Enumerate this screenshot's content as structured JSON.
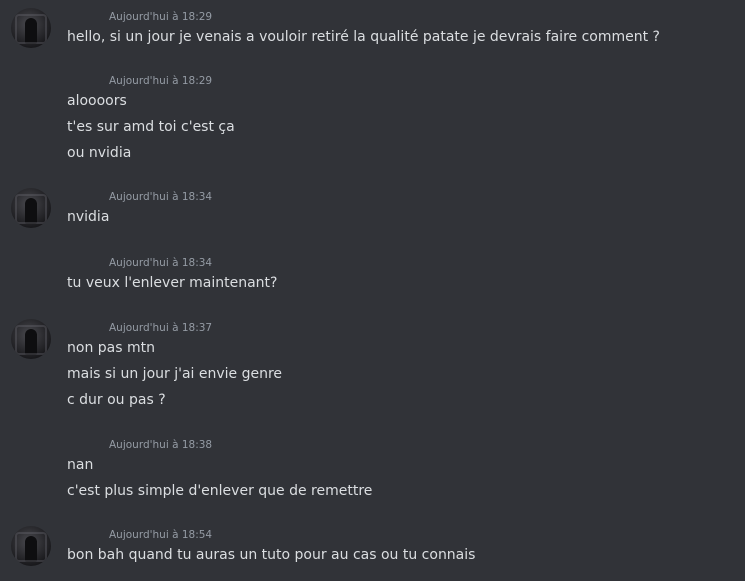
{
  "messages": [
    {
      "timestamp": "Aujourd'hui à 18:29",
      "lines": [
        "hello, si un jour je venais a vouloir retiré la qualité patate je devrais faire comment ?"
      ]
    },
    {
      "timestamp": "Aujourd'hui à 18:29",
      "lines": [
        "aloooors",
        "t'es sur amd toi c'est ça",
        "ou nvidia"
      ]
    },
    {
      "timestamp": "Aujourd'hui à 18:34",
      "lines": [
        "nvidia"
      ]
    },
    {
      "timestamp": "Aujourd'hui à 18:34",
      "lines": [
        "tu veux l'enlever maintenant?"
      ]
    },
    {
      "timestamp": "Aujourd'hui à 18:37",
      "lines": [
        "non pas mtn",
        "mais si un jour j'ai envie genre",
        "c dur ou pas ?"
      ]
    },
    {
      "timestamp": "Aujourd'hui à 18:38",
      "lines": [
        "nan",
        "c'est plus simple d'enlever que de remettre"
      ]
    },
    {
      "timestamp": "Aujourd'hui à 18:54",
      "lines": [
        "bon bah quand tu auras un tuto pour au cas ou tu connais"
      ]
    }
  ]
}
